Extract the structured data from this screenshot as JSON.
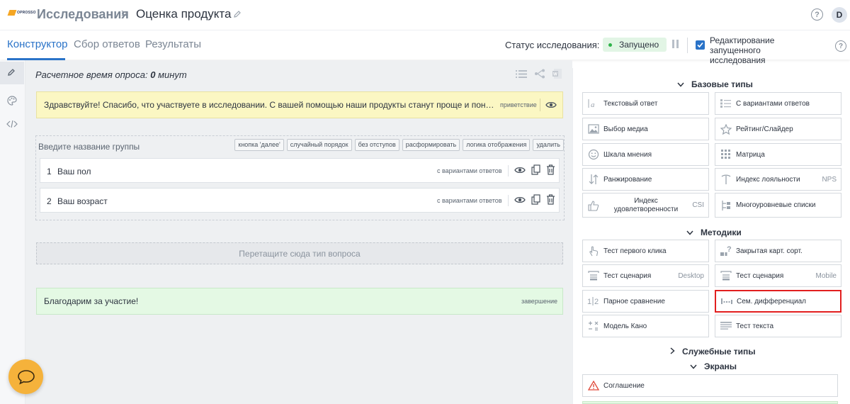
{
  "header": {
    "logo_text": "OPROSSO",
    "crumb_main": "Исследования",
    "crumb_sep": ">",
    "crumb_page": "Оценка продукта",
    "help": "?",
    "avatar": "D"
  },
  "tabs": [
    {
      "label": "Конструктор",
      "active": true
    },
    {
      "label": "Сбор ответов",
      "active": false
    },
    {
      "label": "Результаты",
      "active": false
    }
  ],
  "status": {
    "label": "Статус исследования:",
    "value": "Запущено",
    "edit_label": "Редактирование запущенного исследования",
    "edit_checked": true,
    "help": "?"
  },
  "constructor": {
    "est_time_prefix": "Расчетное время опроса:",
    "est_time_value": "0",
    "est_time_unit": "минут",
    "welcome_text": "Здравствуйте! Спасибо, что участвуете в исследовании. С вашей помощью наши продукты станут проще и понятнее. Ва...",
    "welcome_tag": "приветствие",
    "group_name_placeholder": "Введите название группы",
    "group_actions": [
      "кнопка 'далее'",
      "случайный порядок",
      "без отступов",
      "расформировать",
      "логика отображения",
      "удалить"
    ],
    "questions": [
      {
        "num": "1",
        "text": "Ваш пол",
        "type": "с вариантами ответов"
      },
      {
        "num": "2",
        "text": "Ваш возраст",
        "type": "с вариантами ответов"
      }
    ],
    "dropzone": "Перетащите сюда тип вопроса",
    "finish_text": "Благодарим за участие!",
    "finish_tag": "завершение"
  },
  "palette": {
    "basic_title": "Базовые типы",
    "basic": [
      {
        "label": "Текстовый ответ",
        "icon": "text-icon",
        "suffix": ""
      },
      {
        "label": "С вариантами ответов",
        "icon": "list-icon",
        "suffix": ""
      },
      {
        "label": "Выбор медиа",
        "icon": "image-icon",
        "suffix": ""
      },
      {
        "label": "Рейтинг/Слайдер",
        "icon": "star-icon",
        "suffix": ""
      },
      {
        "label": "Шкала мнения",
        "icon": "smile-icon",
        "suffix": ""
      },
      {
        "label": "Матрица",
        "icon": "grid-icon",
        "suffix": ""
      },
      {
        "label": "Ранжирование",
        "icon": "sort-icon",
        "suffix": ""
      },
      {
        "label": "Индекс лояльности",
        "icon": "gauge-icon",
        "suffix": "NPS"
      },
      {
        "label": "Индекс удовлетворенности",
        "icon": "thumb-icon",
        "suffix": "CSI"
      },
      {
        "label": "Многоуровневые списки",
        "icon": "tree-icon",
        "suffix": ""
      }
    ],
    "methods_title": "Методики",
    "methods": [
      {
        "label": "Тест первого клика",
        "icon": "click-icon",
        "suffix": ""
      },
      {
        "label": "Закрытая карт. сорт.",
        "icon": "card-sort-icon",
        "suffix": ""
      },
      {
        "label": "Тест сценария",
        "icon": "scenario-icon",
        "suffix": "Desktop"
      },
      {
        "label": "Тест сценария",
        "icon": "scenario-icon",
        "suffix": "Mobile"
      },
      {
        "label": "Парное сравнение",
        "icon": "pair-icon",
        "suffix": ""
      },
      {
        "label": "Сем. дифференциал",
        "icon": "semantic-icon",
        "suffix": ""
      },
      {
        "label": "Модель Кано",
        "icon": "kano-icon",
        "suffix": ""
      },
      {
        "label": "Тест текста",
        "icon": "text-test-icon",
        "suffix": ""
      }
    ],
    "service_title": "Служебные типы",
    "screens_title": "Экраны",
    "screens": [
      {
        "label": "Соглашение",
        "icon": "warning-icon"
      }
    ]
  }
}
